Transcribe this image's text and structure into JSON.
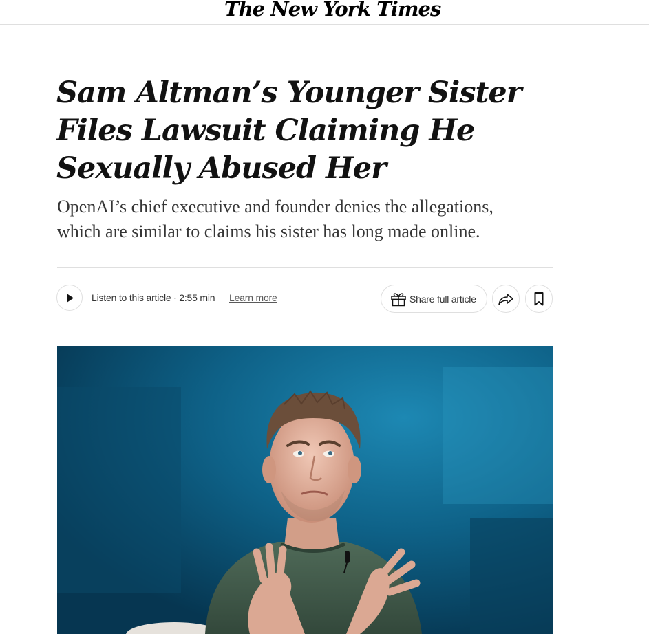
{
  "masthead": {
    "logo": "The New York Times"
  },
  "article": {
    "headline": "Sam Altman’s Younger Sister Files Lawsuit Claiming He Sexually Abused Her",
    "summary": "OpenAI’s chief executive and founder denies the allegations, which are similar to claims his sister has long made online."
  },
  "audio": {
    "listen_label": "Listen to this article · 2:55 min",
    "learn_more": "Learn more"
  },
  "actions": {
    "share_full_article": "Share full article"
  },
  "icons": {
    "play": "play-icon",
    "gift": "gift-icon",
    "share": "share-icon",
    "bookmark": "bookmark-icon"
  },
  "colors": {
    "text": "#121212",
    "summary_text": "#363636",
    "border": "#dfdfdf",
    "photo_background": "#0d5b7f"
  }
}
